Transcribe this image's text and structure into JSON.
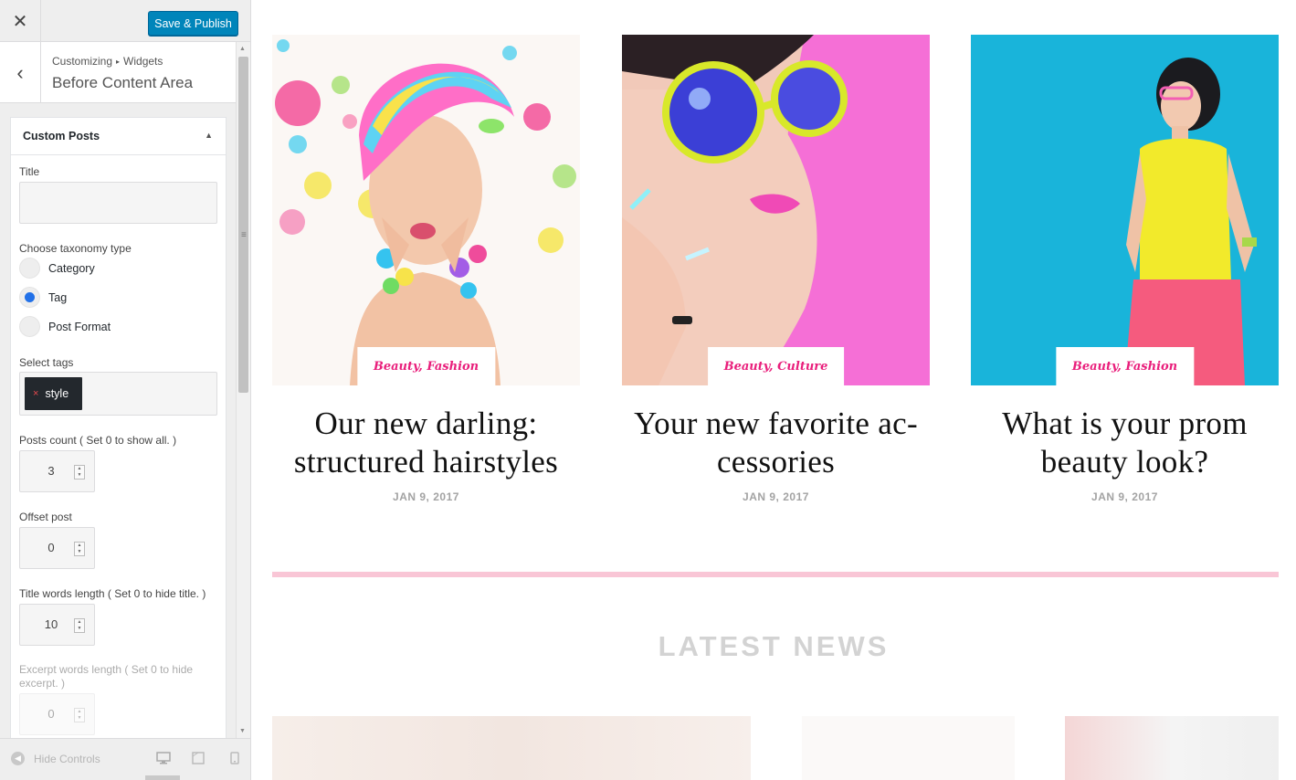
{
  "sidebar": {
    "close_label": "✕",
    "publish_label": "Save & Publish",
    "back_label": "‹",
    "breadcrumb": {
      "root": "Customizing",
      "separator": "▸",
      "current": "Widgets"
    },
    "section_title": "Before Content Area",
    "widget": {
      "title": "Custom Posts",
      "toggle_icon": "▲",
      "fields": {
        "title_label": "Title",
        "title_value": "",
        "taxonomy_label": "Choose taxonomy type",
        "taxonomy_options": [
          "Category",
          "Tag",
          "Post Format"
        ],
        "taxonomy_selected": "Tag",
        "tags_label": "Select tags",
        "tags": [
          {
            "remove": "×",
            "label": "style"
          }
        ],
        "posts_count_label": "Posts count ( Set 0 to show all. )",
        "posts_count_value": "3",
        "offset_label": "Offset post",
        "offset_value": "0",
        "title_words_label": "Title words length ( Set 0 to hide title. )",
        "title_words_value": "10",
        "excerpt_words_label": "Excerpt words length ( Set 0 to hide excerpt. )",
        "excerpt_words_value": "0"
      }
    },
    "footer": {
      "hide_controls_label": "Hide Controls"
    }
  },
  "preview": {
    "posts": [
      {
        "category": "Beauty, Fashion",
        "title_line1": "Our new darling:",
        "title_line2": "structured hairstyles",
        "date": "JAN 9, 2017"
      },
      {
        "category": "Beauty, Culture",
        "title_line1": "Your new favorite ac-",
        "title_line2": "cessories",
        "date": "JAN 9, 2017"
      },
      {
        "category": "Beauty, Fashion",
        "title_line1": "What is your prom",
        "title_line2": "beauty look?",
        "date": "JAN 9, 2017"
      }
    ],
    "latest_news_heading": "LATEST NEWS"
  },
  "colors": {
    "publish_button": "#0085ba",
    "category_text": "#e91e7b",
    "divider": "#f9c6d6",
    "radio_selected": "#2271e8"
  }
}
